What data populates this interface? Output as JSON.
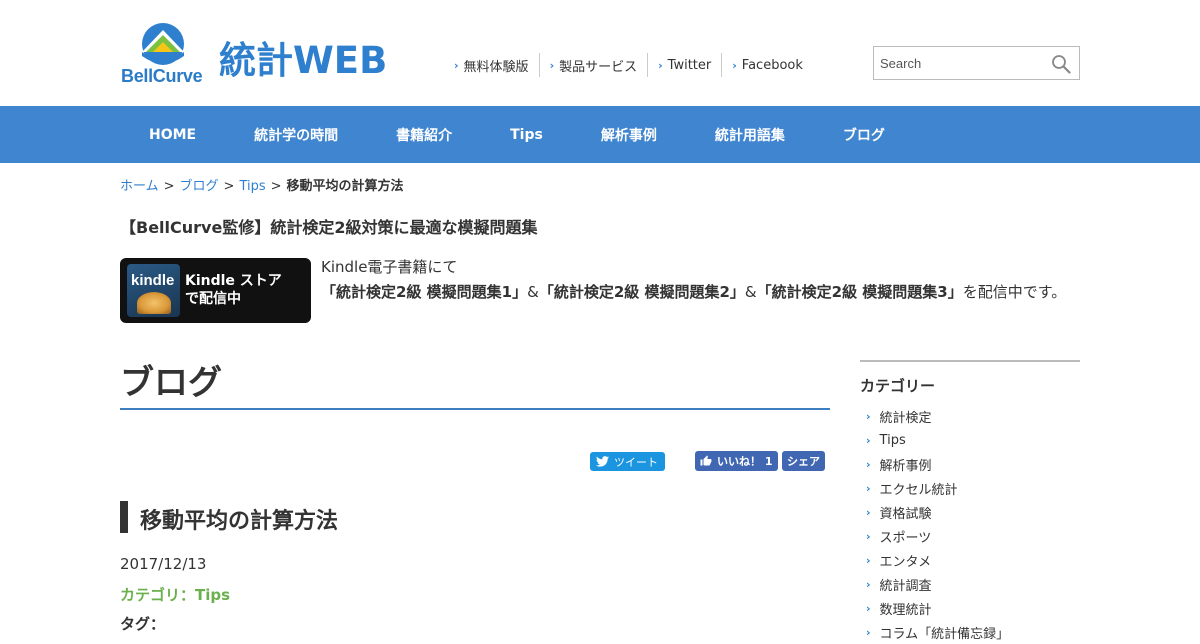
{
  "header": {
    "logo_text": "BellCurve",
    "site_name": "統計WEB",
    "top_links": [
      "無料体験版",
      "製品サービス",
      "Twitter",
      "Facebook"
    ],
    "search": {
      "placeholder": "Search"
    }
  },
  "nav": {
    "items": [
      "HOME",
      "統計学の時間",
      "書籍紹介",
      "Tips",
      "解析事例",
      "統計用語集",
      "ブログ"
    ]
  },
  "breadcrumb": {
    "items": [
      "ホーム",
      "ブログ",
      "Tips"
    ],
    "separator": ">",
    "current": "移動平均の計算方法"
  },
  "promo": {
    "title": "【BellCurve監修】統計検定2級対策に最適な模擬問題集",
    "badge_line1": "Kindle ストア",
    "badge_line2": "で配信中",
    "badge_icon_word": "kindle",
    "text_intro": "Kindle電子書籍にて",
    "book1": "「統計検定2級 模擬問題集1」",
    "amp": "&",
    "book2": "「統計検定2級 模擬問題集2」",
    "book3": "「統計検定2級 模擬問題集3」",
    "text_outro": "を配信中です。"
  },
  "main": {
    "heading": "ブログ",
    "social": {
      "tweet": "ツイート",
      "like": "いいね！ 1",
      "share": "シェア"
    },
    "post": {
      "title": "移動平均の計算方法",
      "date": "2017/12/13",
      "category": "カテゴリ：Tips",
      "tag_label": "タグ："
    }
  },
  "sidebar": {
    "title": "カテゴリー",
    "items": [
      "統計検定",
      "Tips",
      "解析事例",
      "エクセル統計",
      "資格試験",
      "スポーツ",
      "エンタメ",
      "統計調査",
      "数理統計",
      "コラム「統計備忘録」"
    ]
  },
  "colors": {
    "brand_blue": "#3f85d0",
    "category_green": "#6ab04c",
    "twitter": "#1b95e0",
    "facebook": "#4267b2"
  }
}
